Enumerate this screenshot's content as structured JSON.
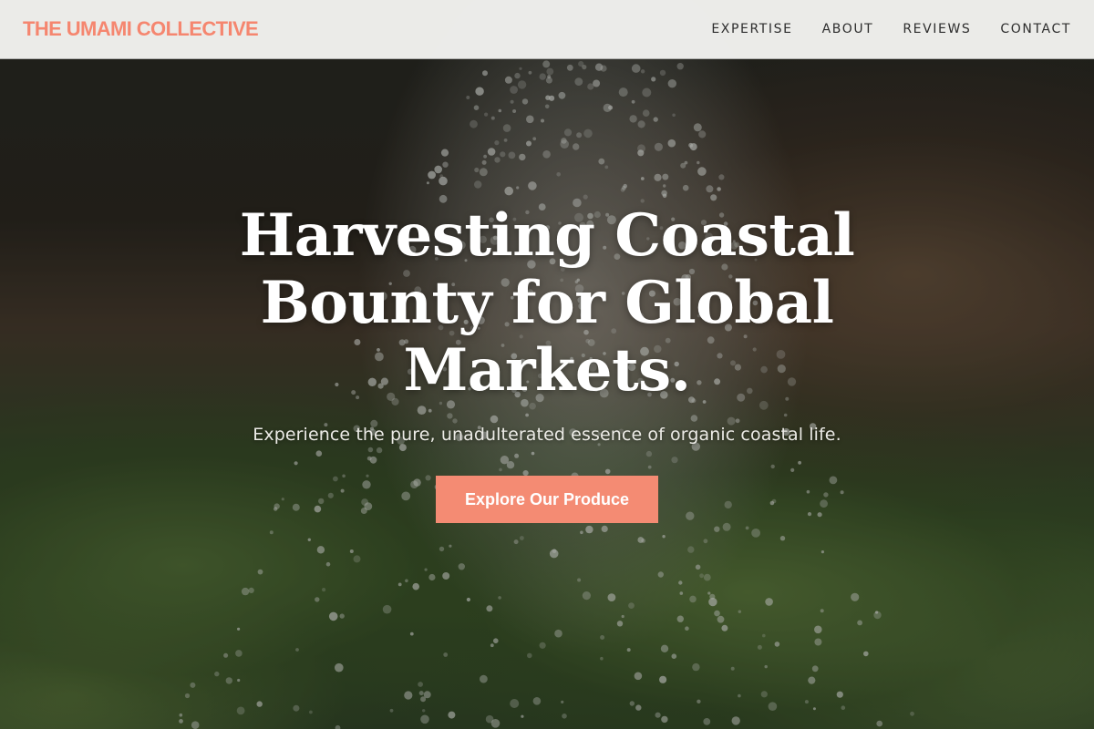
{
  "brand": {
    "name": "THE UMAMI COLLECTIVE",
    "color": "#f5866f"
  },
  "nav": {
    "items": [
      {
        "label": "EXPERTISE"
      },
      {
        "label": "ABOUT"
      },
      {
        "label": "REVIEWS"
      },
      {
        "label": "CONTACT"
      }
    ]
  },
  "hero": {
    "title": "Harvesting Coastal Bounty for Global Markets.",
    "subtitle": "Experience the pure, unadulterated essence of organic coastal life.",
    "cta_label": "Explore Our Produce",
    "cta_color": "#f48b73",
    "background_image": "water droplets falling on leafy green plants"
  }
}
